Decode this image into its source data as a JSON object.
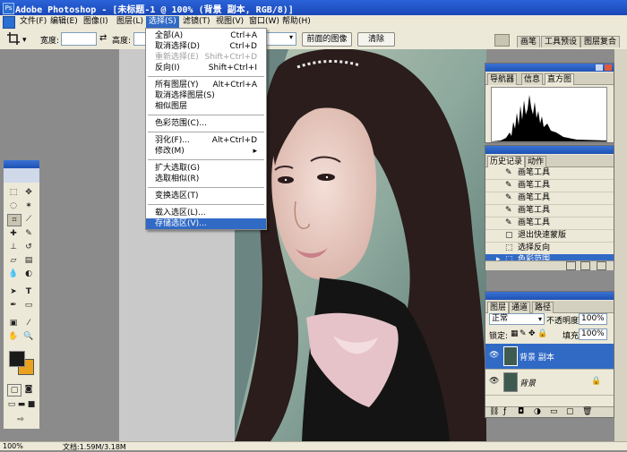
{
  "window": {
    "title": "Adobe Photoshop - [未标题-1 @ 100% (背景 副本, RGB/8)]",
    "app_icon": "Ps"
  },
  "menubar": {
    "items": [
      "文件(F)",
      "编辑(E)",
      "图像(I)",
      "图层(L)",
      "选择(S)",
      "滤镜(T)",
      "视图(V)",
      "窗口(W)",
      "帮助(H)"
    ],
    "active": "选择(S)"
  },
  "options_bar": {
    "width_label": "宽度:",
    "height_label": "高度:",
    "front_image_button": "前面的图像",
    "clear_button": "清除",
    "palette_well_tabs": [
      "画笔",
      "工具预设",
      "图层复合"
    ]
  },
  "select_menu": {
    "items": [
      {
        "label": "全部(A)",
        "shortcut": "Ctrl+A",
        "disabled": false
      },
      {
        "label": "取消选择(D)",
        "shortcut": "Ctrl+D",
        "disabled": false
      },
      {
        "label": "重新选择(E)",
        "shortcut": "Shift+Ctrl+D",
        "disabled": true
      },
      {
        "label": "反向(I)",
        "shortcut": "Shift+Ctrl+I",
        "disabled": false
      },
      {
        "label": "所有图层(Y)",
        "shortcut": "Alt+Ctrl+A",
        "disabled": false
      },
      {
        "label": "取消选择图层(S)",
        "shortcut": "",
        "disabled": false
      },
      {
        "label": "相似图层",
        "shortcut": "",
        "disabled": false
      },
      {
        "label": "色彩范围(C)...",
        "shortcut": "",
        "disabled": false
      },
      {
        "label": "羽化(F)...",
        "shortcut": "Alt+Ctrl+D",
        "disabled": false
      },
      {
        "label": "修改(M)",
        "shortcut": "▸",
        "disabled": false
      },
      {
        "label": "扩大选取(G)",
        "shortcut": "",
        "disabled": false
      },
      {
        "label": "选取相似(R)",
        "shortcut": "",
        "disabled": false
      },
      {
        "label": "变换选区(T)",
        "shortcut": "",
        "disabled": false
      },
      {
        "label": "载入选区(L)...",
        "shortcut": "",
        "disabled": false
      },
      {
        "label": "存储选区(V)...",
        "shortcut": "",
        "disabled": false,
        "highlighted": true
      }
    ]
  },
  "navigator_panel": {
    "tabs": [
      "导航器",
      "信息",
      "直方图"
    ],
    "selected": "直方图"
  },
  "history_panel": {
    "tabs": [
      "历史记录",
      "动作"
    ],
    "items": [
      "画笔工具",
      "画笔工具",
      "画笔工具",
      "画笔工具",
      "画笔工具",
      "退出快速蒙版",
      "选择反向",
      "色彩范围"
    ],
    "selected_index": 7
  },
  "layers_panel": {
    "tabs": [
      "图层",
      "通道",
      "路径"
    ],
    "blend_mode": "正常",
    "opacity_label": "不透明度:",
    "opacity": "100%",
    "lock_label": "锁定:",
    "fill_label": "填充:",
    "fill": "100%",
    "layers": [
      {
        "name": "背景 副本",
        "selected": true,
        "locked": false
      },
      {
        "name": "背景",
        "selected": false,
        "locked": true
      }
    ]
  },
  "status_bar": {
    "zoom": "100%",
    "doc_info": "文档:1.59M/3.18M"
  },
  "colors": {
    "foreground": "#1a1a1a",
    "background": "#e8a21f",
    "menu_highlight": "#316ac5",
    "titlebar": "#1f4fb8"
  }
}
